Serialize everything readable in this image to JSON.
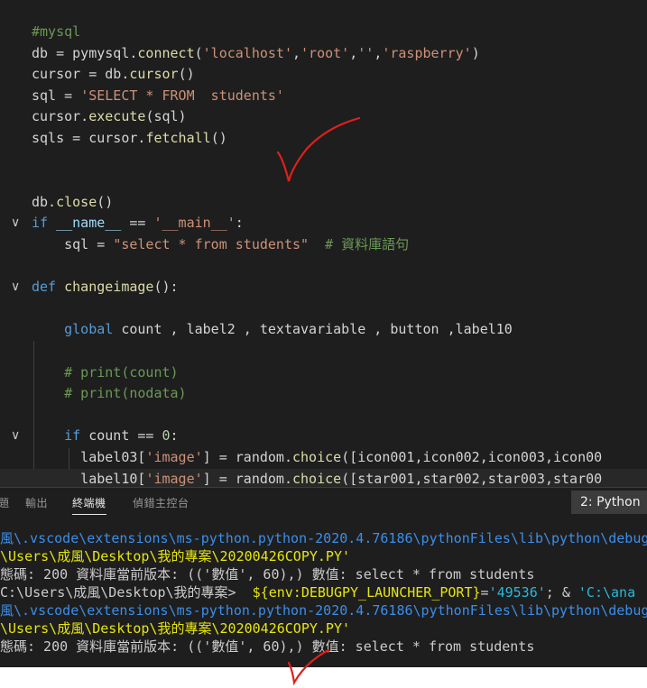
{
  "editor": {
    "lines": [
      {
        "parts": [
          {
            "t": "#mysql",
            "c": "cm"
          }
        ]
      },
      {
        "parts": [
          {
            "t": "db = pymysql.",
            "c": "op"
          },
          {
            "t": "connect",
            "c": "fn"
          },
          {
            "t": "(",
            "c": "op"
          },
          {
            "t": "'localhost'",
            "c": "str"
          },
          {
            "t": ",",
            "c": "op"
          },
          {
            "t": "'root'",
            "c": "str"
          },
          {
            "t": ",",
            "c": "op"
          },
          {
            "t": "''",
            "c": "str"
          },
          {
            "t": ",",
            "c": "op"
          },
          {
            "t": "'raspberry'",
            "c": "str"
          },
          {
            "t": ")",
            "c": "op"
          }
        ]
      },
      {
        "parts": [
          {
            "t": "cursor = db.",
            "c": "op"
          },
          {
            "t": "cursor",
            "c": "fn"
          },
          {
            "t": "()",
            "c": "op"
          }
        ]
      },
      {
        "parts": [
          {
            "t": "sql = ",
            "c": "op"
          },
          {
            "t": "'SELECT * FROM  students'",
            "c": "str"
          }
        ]
      },
      {
        "parts": [
          {
            "t": "cursor.",
            "c": "op"
          },
          {
            "t": "execute",
            "c": "fn"
          },
          {
            "t": "(sql)",
            "c": "op"
          }
        ]
      },
      {
        "parts": [
          {
            "t": "sqls = cursor.",
            "c": "op"
          },
          {
            "t": "fetchall",
            "c": "fn"
          },
          {
            "t": "()",
            "c": "op"
          }
        ]
      },
      {
        "parts": []
      },
      {
        "parts": []
      },
      {
        "parts": [
          {
            "t": "db.",
            "c": "op"
          },
          {
            "t": "close",
            "c": "fn"
          },
          {
            "t": "()",
            "c": "op"
          }
        ]
      },
      {
        "fold": true,
        "parts": [
          {
            "t": "if",
            "c": "kw"
          },
          {
            "t": " ",
            "c": "op"
          },
          {
            "t": "__name__",
            "c": "var"
          },
          {
            "t": " == ",
            "c": "op"
          },
          {
            "t": "'__main__'",
            "c": "str"
          },
          {
            "t": ":",
            "c": "op"
          }
        ]
      },
      {
        "parts": [
          {
            "t": "    sql = ",
            "c": "op"
          },
          {
            "t": "\"select * from students\"",
            "c": "str"
          },
          {
            "t": "  ",
            "c": "op"
          },
          {
            "t": "# 資料庫語句",
            "c": "cm"
          }
        ]
      },
      {
        "parts": []
      },
      {
        "fold": true,
        "parts": [
          {
            "t": "def",
            "c": "kw"
          },
          {
            "t": " ",
            "c": "op"
          },
          {
            "t": "changeimage",
            "c": "fn"
          },
          {
            "t": "():",
            "c": "op"
          }
        ]
      },
      {
        "parts": []
      },
      {
        "parts": [
          {
            "t": "    ",
            "c": "op"
          },
          {
            "t": "global",
            "c": "kw"
          },
          {
            "t": " count , label2 , textavariable , button ,label10",
            "c": "op"
          }
        ]
      },
      {
        "parts": []
      },
      {
        "parts": [
          {
            "t": "    # print(count)",
            "c": "cm"
          }
        ]
      },
      {
        "parts": [
          {
            "t": "    # print(nodata)",
            "c": "cm"
          }
        ]
      },
      {
        "parts": []
      },
      {
        "fold": true,
        "parts": [
          {
            "t": "    ",
            "c": "op"
          },
          {
            "t": "if",
            "c": "kw"
          },
          {
            "t": " count == ",
            "c": "op"
          },
          {
            "t": "0",
            "c": "num"
          },
          {
            "t": ":",
            "c": "op"
          }
        ]
      },
      {
        "parts": [
          {
            "t": "      label03[",
            "c": "op"
          },
          {
            "t": "'image'",
            "c": "str"
          },
          {
            "t": "] = random.",
            "c": "op"
          },
          {
            "t": "choice",
            "c": "fn"
          },
          {
            "t": "([icon001,icon002,icon003,icon00",
            "c": "op"
          }
        ]
      },
      {
        "current": true,
        "parts": [
          {
            "t": "      label10[",
            "c": "op"
          },
          {
            "t": "'image'",
            "c": "str"
          },
          {
            "t": "] = random.",
            "c": "op"
          },
          {
            "t": "choice",
            "c": "fn"
          },
          {
            "t": "([star001,star002,star003,star00",
            "c": "op"
          }
        ]
      }
    ]
  },
  "panel": {
    "tabs": [
      {
        "label": "題",
        "active": false
      },
      {
        "label": "輸出",
        "active": false
      },
      {
        "label": "終端機",
        "active": true
      },
      {
        "label": "偵錯主控台",
        "active": false
      }
    ],
    "terminal_select": "2: Python"
  },
  "terminal": {
    "lines": [
      {
        "parts": [
          {
            "t": "風\\.vscode\\extensions\\ms-python.python-2020.4.76186\\pythonFiles\\lib\\python\\debug",
            "c": "path"
          }
        ]
      },
      {
        "parts": [
          {
            "t": "\\Users\\成風\\Desktop\\我的專案\\20200426COPY.PY'",
            "c": "yl"
          }
        ]
      },
      {
        "parts": [
          {
            "t": "態碼: 200 資料庫當前版本: (('數值', 60),) 數值: select * from students",
            "c": "plain"
          }
        ]
      },
      {
        "parts": [
          {
            "t": "C:\\Users\\成風\\Desktop\\我的專案>  ",
            "c": "plain"
          },
          {
            "t": "${env:DEBUGPY_LAUNCHER_PORT}",
            "c": "yl"
          },
          {
            "t": "=",
            "c": "plain"
          },
          {
            "t": "'49536'",
            "c": "cy"
          },
          {
            "t": "; & ",
            "c": "plain"
          },
          {
            "t": "'C:\\ana",
            "c": "cy"
          }
        ]
      },
      {
        "parts": [
          {
            "t": "風\\.vscode\\extensions\\ms-python.python-2020.4.76186\\pythonFiles\\lib\\python\\debug",
            "c": "path"
          }
        ]
      },
      {
        "parts": [
          {
            "t": "\\Users\\成風\\Desktop\\我的專案\\20200426COPY.PY'",
            "c": "yl"
          }
        ]
      },
      {
        "parts": [
          {
            "t": "態碼: 200 資料庫當前版本: (('數值', 60),) 數值: select * from students",
            "c": "plain"
          }
        ]
      }
    ]
  },
  "colors": {
    "editor_bg": "#1e1e1e",
    "keyword": "#569cd6",
    "function": "#dcdcaa",
    "string": "#ce9178",
    "comment": "#6a9955",
    "annotation_red": "#e0201a"
  },
  "icons": {
    "fold": "chevron-down-icon",
    "annotation": "handdrawn-checkmark"
  }
}
